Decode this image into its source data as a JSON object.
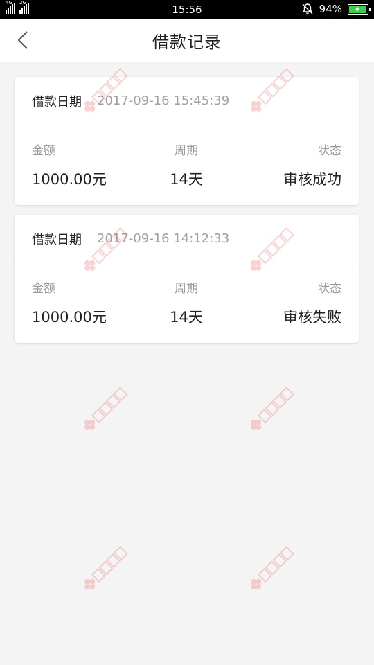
{
  "status_bar": {
    "net1": "4G",
    "net2": "2G",
    "time": "15:56",
    "battery": "94%"
  },
  "header": {
    "title": "借款记录"
  },
  "records": [
    {
      "date_label": "借款日期",
      "date": "2017-09-16 15:45:39",
      "amount_label": "金额",
      "amount": "1000.00元",
      "period_label": "周期",
      "period": "14天",
      "status_label": "状态",
      "status": "审核成功"
    },
    {
      "date_label": "借款日期",
      "date": "2017-09-16 14:12:33",
      "amount_label": "金额",
      "amount": "1000.00元",
      "period_label": "周期",
      "period": "14天",
      "status_label": "状态",
      "status": "审核失败"
    }
  ],
  "watermark": {
    "text": "卡农社区",
    "color": "#f08080"
  },
  "colors": {
    "background": "#f4f4f4",
    "battery": "#37d049"
  }
}
